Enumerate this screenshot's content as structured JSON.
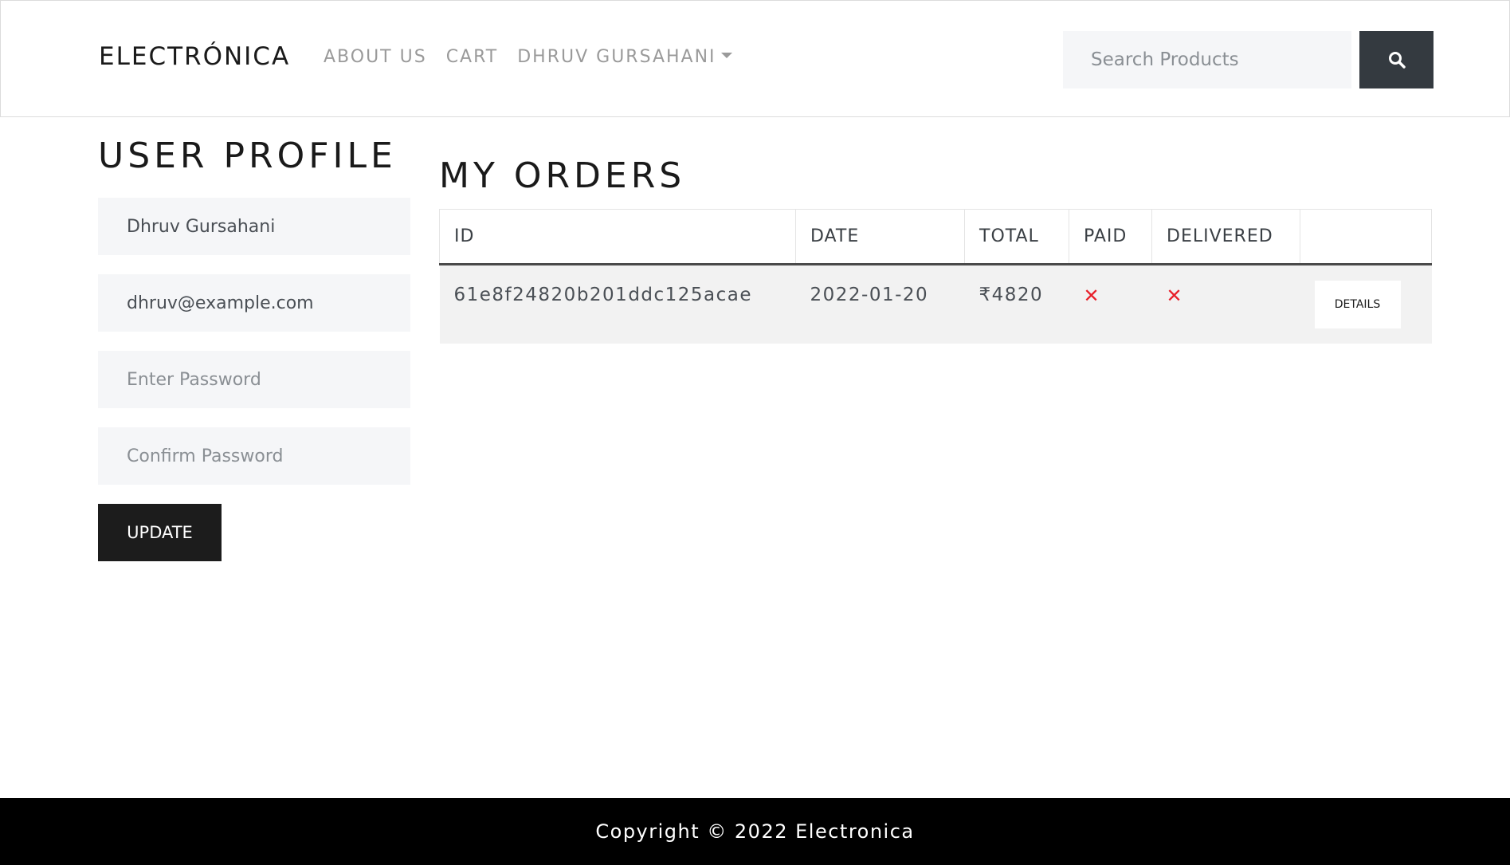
{
  "navbar": {
    "brand": "ELECTRÓNICA",
    "links": [
      {
        "label": "ABOUT US"
      },
      {
        "label": "CART"
      },
      {
        "label": "DHRUV GURSAHANI"
      }
    ],
    "search": {
      "placeholder": "Search Products",
      "value": "",
      "icon": "search-icon"
    }
  },
  "profile": {
    "title": "USER PROFILE",
    "name_value": "Dhruv Gursahani",
    "email_value": "dhruv@example.com",
    "password_placeholder": "Enter Password",
    "confirm_placeholder": "Confirm Password",
    "update_label": "UPDATE"
  },
  "orders": {
    "title": "MY ORDERS",
    "columns": [
      "ID",
      "DATE",
      "TOTAL",
      "PAID",
      "DELIVERED",
      ""
    ],
    "rows": [
      {
        "id": "61e8f24820b201ddc125acae",
        "date": "2022-01-20",
        "total": "₹4820",
        "paid": "✕",
        "delivered": "✕",
        "action": "DETAILS"
      }
    ]
  },
  "footer": {
    "text": "Copyright © 2022 Electronica"
  },
  "colors": {
    "accent_dark": "#343a40",
    "error": "#e8202a",
    "footer_bg": "#000000"
  }
}
